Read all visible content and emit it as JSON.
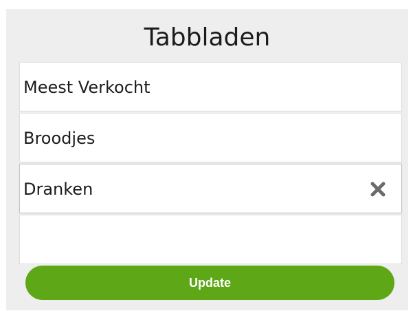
{
  "header": {
    "title": "Tabbladen"
  },
  "tabs": [
    {
      "label": "Meest Verkocht"
    },
    {
      "label": "Broodjes"
    },
    {
      "label": "Dranken",
      "active": true,
      "delete_icon": "close-icon"
    },
    {
      "label": ""
    }
  ],
  "actions": {
    "update_label": "Update"
  },
  "colors": {
    "panel_background": "#eeeeee",
    "update_button": "#5ea818",
    "delete_icon": "#6b6b6b"
  }
}
